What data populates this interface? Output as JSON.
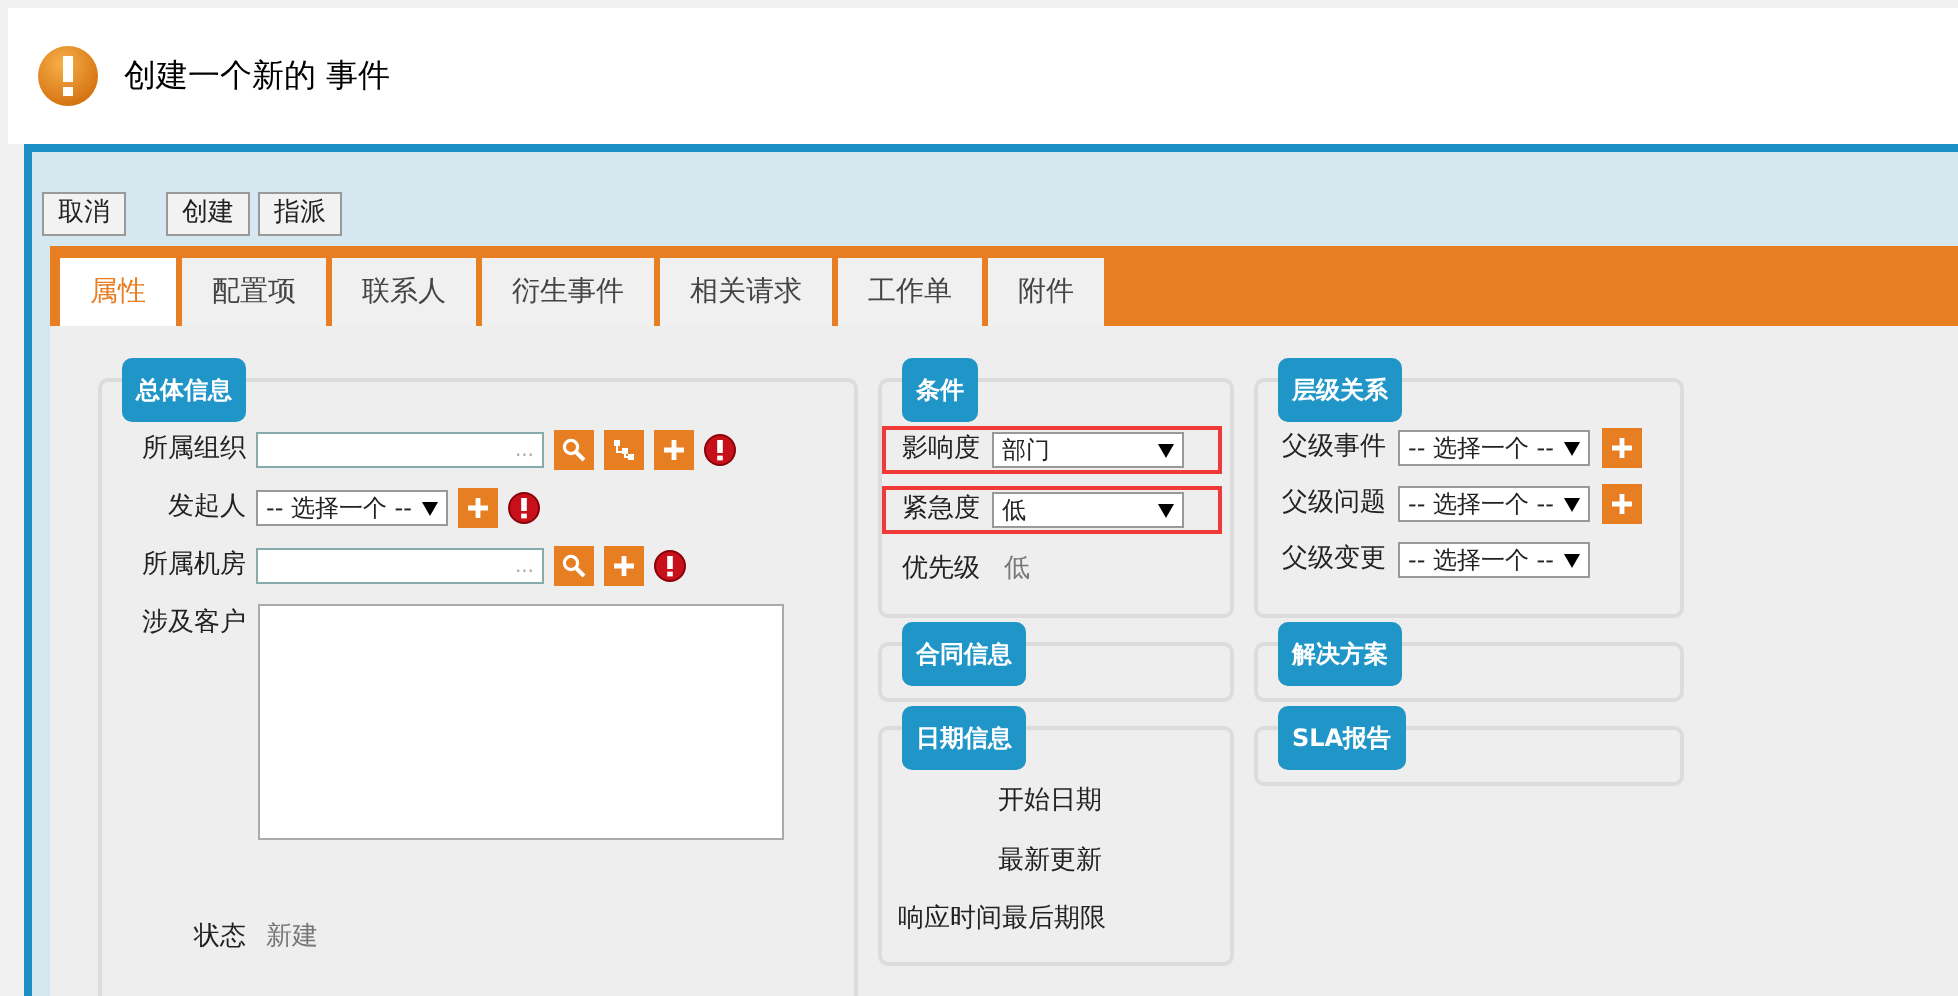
{
  "header": {
    "title": "创建一个新的 事件"
  },
  "toolbar": {
    "group_1": [
      "取消"
    ],
    "group_2": [
      "创建",
      "指派"
    ]
  },
  "tabs": [
    {
      "label": "属性",
      "selected": true
    },
    {
      "label": "配置项",
      "selected": false
    },
    {
      "label": "联系人",
      "selected": false
    },
    {
      "label": "衍生事件",
      "selected": false
    },
    {
      "label": "相关请求",
      "selected": false
    },
    {
      "label": "工作单",
      "selected": false
    },
    {
      "label": "附件",
      "selected": false
    }
  ],
  "general": {
    "title": "总体信息",
    "fields": [
      {
        "kind": "lookup",
        "label": "所属组织",
        "ellipsis": "...",
        "actions": [
          {
            "kind": "search"
          },
          {
            "kind": "tree"
          },
          {
            "kind": "add"
          }
        ],
        "required": true
      },
      {
        "kind": "select",
        "label": "发起人",
        "value": "-- 选择一个 --",
        "actions": [
          {
            "kind": "add"
          }
        ],
        "required": true
      },
      {
        "kind": "lookup",
        "label": "所属机房",
        "ellipsis": "...",
        "actions": [
          {
            "kind": "search"
          },
          {
            "kind": "add"
          }
        ],
        "required": true
      },
      {
        "kind": "textarea",
        "label": "涉及客户"
      },
      {
        "kind": "readonly",
        "label": "状态",
        "value": "新建"
      }
    ]
  },
  "conditions": {
    "title": "条件",
    "fields": [
      {
        "kind": "select",
        "label": "影响度",
        "value": "部门",
        "highlighted": true
      },
      {
        "kind": "select",
        "label": "紧急度",
        "value": "低",
        "highlighted": true
      },
      {
        "kind": "readonly",
        "label": "优先级",
        "value": "低",
        "highlighted": false
      }
    ]
  },
  "contract": {
    "title": "合同信息"
  },
  "dates": {
    "title": "日期信息",
    "labels": [
      "开始日期",
      "最新更新",
      "响应时间最后期限"
    ]
  },
  "hierarchy": {
    "title": "层级关系",
    "fields": [
      {
        "label": "父级事件",
        "value": "-- 选择一个 --",
        "add": true
      },
      {
        "label": "父级问题",
        "value": "-- 选择一个 --",
        "add": true
      },
      {
        "label": "父级变更",
        "value": "-- 选择一个 --",
        "add": false
      }
    ]
  },
  "solution": {
    "title": "解决方案"
  },
  "sla": {
    "title": "SLA报告"
  }
}
